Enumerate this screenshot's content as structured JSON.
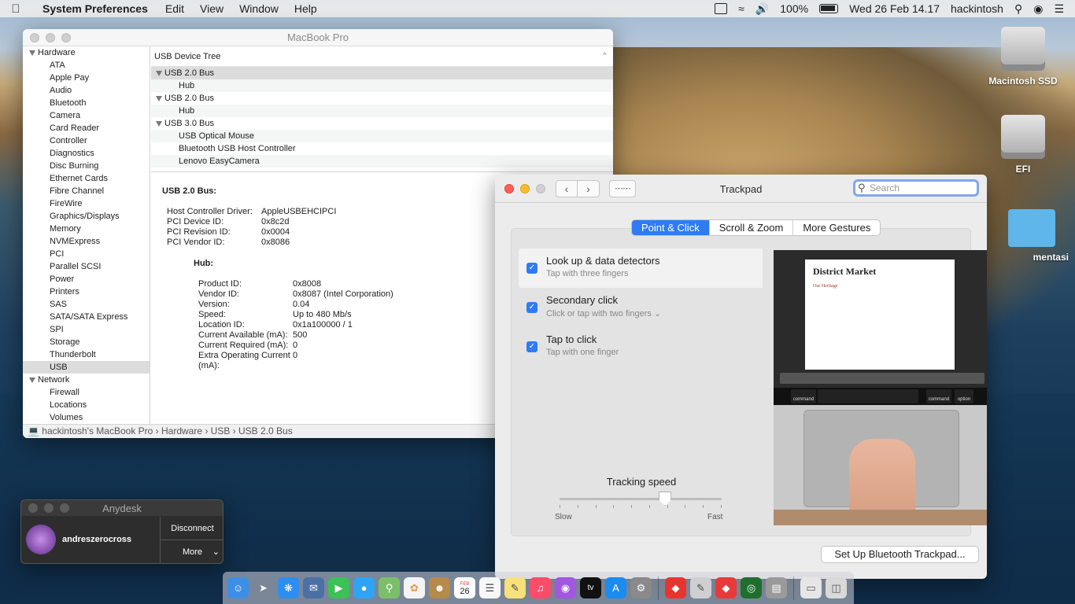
{
  "menubar": {
    "app_name": "System Preferences",
    "menus": [
      "Edit",
      "View",
      "Window",
      "Help"
    ],
    "battery": "100%",
    "datetime": "Wed 26 Feb 14.17",
    "user": "hackintosh"
  },
  "desktop": {
    "icons": [
      "Macintosh SSD",
      "EFI",
      "mentasi"
    ]
  },
  "sysinfo": {
    "title": "MacBook Pro",
    "sidebar": {
      "hardware_label": "Hardware",
      "hardware_items": [
        "ATA",
        "Apple Pay",
        "Audio",
        "Bluetooth",
        "Camera",
        "Card Reader",
        "Controller",
        "Diagnostics",
        "Disc Burning",
        "Ethernet Cards",
        "Fibre Channel",
        "FireWire",
        "Graphics/Displays",
        "Memory",
        "NVMExpress",
        "PCI",
        "Parallel SCSI",
        "Power",
        "Printers",
        "SAS",
        "SATA/SATA Express",
        "SPI",
        "Storage",
        "Thunderbolt",
        "USB"
      ],
      "selected": "USB",
      "network_label": "Network",
      "network_items": [
        "Firewall",
        "Locations",
        "Volumes"
      ]
    },
    "tree": {
      "header": "USB Device Tree",
      "rows": [
        {
          "label": "USB 2.0 Bus",
          "level": 0
        },
        {
          "label": "Hub",
          "level": 1
        },
        {
          "label": "USB 2.0 Bus",
          "level": 0
        },
        {
          "label": "Hub",
          "level": 1
        },
        {
          "label": "USB 3.0 Bus",
          "level": 0
        },
        {
          "label": "USB Optical Mouse",
          "level": 1
        },
        {
          "label": "Bluetooth USB Host Controller",
          "level": 1
        },
        {
          "label": "Lenovo EasyCamera",
          "level": 1
        }
      ]
    },
    "detail": {
      "heading": "USB 2.0 Bus:",
      "bus_props": [
        {
          "k": "Host Controller Driver:",
          "v": "AppleUSBEHCIPCI"
        },
        {
          "k": "PCI Device ID:",
          "v": "0x8c2d"
        },
        {
          "k": "PCI Revision ID:",
          "v": "0x0004"
        },
        {
          "k": "PCI Vendor ID:",
          "v": "0x8086"
        }
      ],
      "hub_heading": "Hub:",
      "hub_props": [
        {
          "k": "Product ID:",
          "v": "0x8008"
        },
        {
          "k": "Vendor ID:",
          "v": "0x8087  (Intel Corporation)"
        },
        {
          "k": "Version:",
          "v": "0.04"
        },
        {
          "k": "Speed:",
          "v": "Up to 480 Mb/s"
        },
        {
          "k": "Location ID:",
          "v": "0x1a100000 / 1"
        },
        {
          "k": "Current Available (mA):",
          "v": "500"
        },
        {
          "k": "Current Required (mA):",
          "v": "0"
        },
        {
          "k": "Extra Operating Current (mA):",
          "v": "0"
        }
      ]
    },
    "breadcrumb": "hackintosh's MacBook Pro › Hardware › USB › USB 2.0 Bus"
  },
  "trackpad": {
    "title": "Trackpad",
    "search_placeholder": "Search",
    "tabs": [
      "Point & Click",
      "Scroll & Zoom",
      "More Gestures"
    ],
    "active_tab": "Point & Click",
    "options": [
      {
        "title": "Look up & data detectors",
        "sub": "Tap with three fingers",
        "checked": true
      },
      {
        "title": "Secondary click",
        "sub": "Click or tap with two fingers ⌄",
        "checked": true
      },
      {
        "title": "Tap to click",
        "sub": "Tap with one finger",
        "checked": true
      }
    ],
    "preview": {
      "doc_title": "District Market",
      "doc_heading": "Our Heritage",
      "key_labels": [
        "command",
        "command",
        "option"
      ]
    },
    "tracking_speed": {
      "label": "Tracking speed",
      "min_label": "Slow",
      "max_label": "Fast",
      "value": 0.65
    },
    "setup_button": "Set Up Bluetooth Trackpad...",
    "help_button": "?"
  },
  "anydesk": {
    "title": "Anydesk",
    "user": "andreszerocross",
    "disconnect": "Disconnect",
    "more": "More"
  },
  "dock": {
    "calendar_month": "FEB",
    "calendar_day": "26",
    "apple_tv": "tv"
  }
}
